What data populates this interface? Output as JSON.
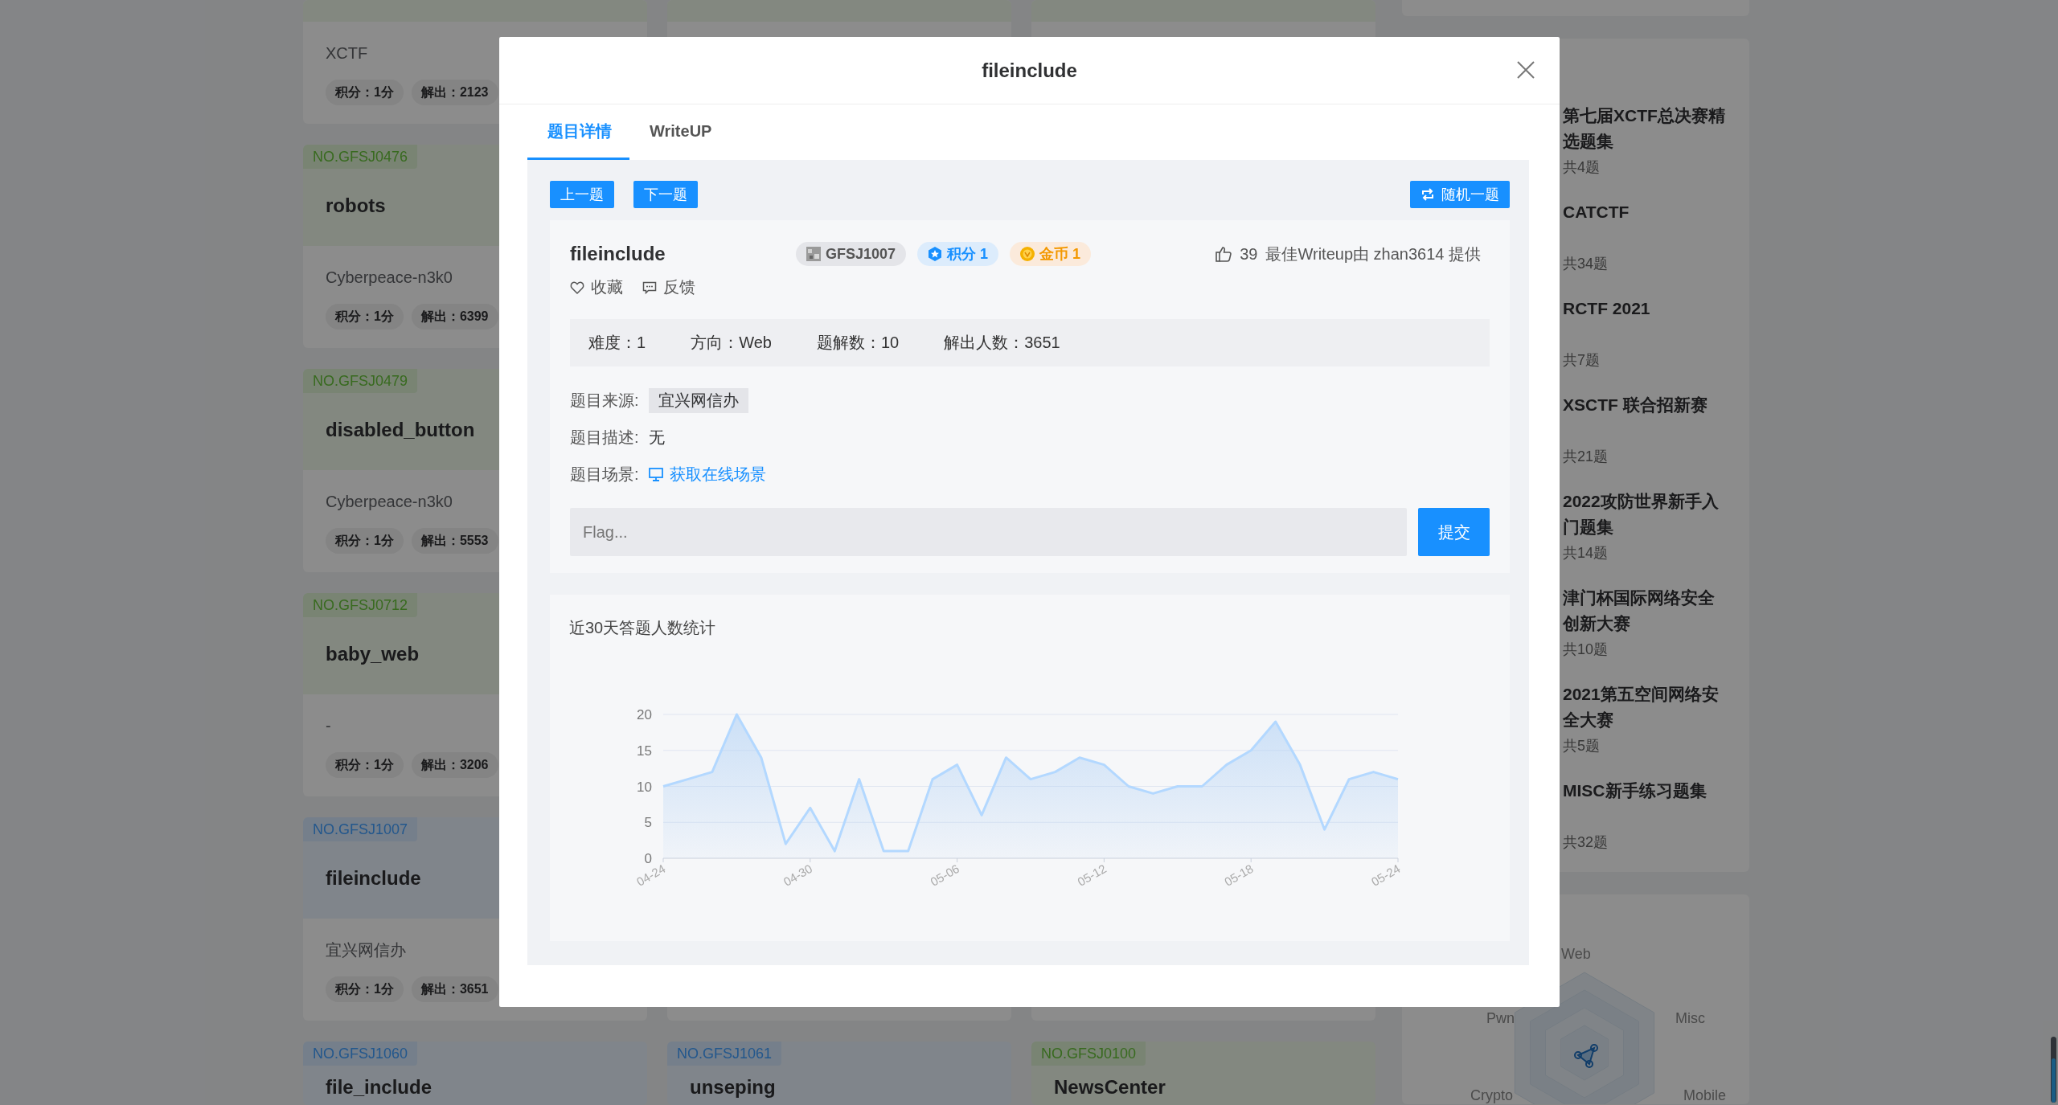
{
  "background": {
    "challenge_grid": {
      "rows": [
        [
          {
            "kind": "green",
            "author": "XCTF",
            "points": "积分：1分",
            "solves": "解出：2123"
          },
          {
            "kind": "green"
          },
          {
            "kind": "green"
          }
        ],
        [
          {
            "kind": "green",
            "tag": "NO.GFSJ0476",
            "title": "robots",
            "author": "Cyberpeace-n3k0",
            "points": "积分：1分",
            "solves": "解出：6399"
          }
        ],
        [
          {
            "kind": "green",
            "tag": "NO.GFSJ0479",
            "title": "disabled_button",
            "author": "Cyberpeace-n3k0",
            "points": "积分：1分",
            "solves": "解出：5553"
          }
        ],
        [
          {
            "kind": "green",
            "tag": "NO.GFSJ0712",
            "title": "baby_web",
            "author": "-",
            "points": "积分：1分",
            "solves": "解出：3206"
          }
        ],
        [
          {
            "kind": "blue",
            "tag": "NO.GFSJ1007",
            "title": "fileinclude",
            "author": "宜兴网信办",
            "points": "积分：1分",
            "solves": "解出：3651"
          }
        ],
        [
          {
            "kind": "blue",
            "tag": "NO.GFSJ1060",
            "title": "file_include"
          },
          {
            "kind": "blue",
            "tag": "NO.GFSJ1061",
            "title": "unseping"
          },
          {
            "kind": "green",
            "tag": "NO.GFSJ0100",
            "title": "NewsCenter"
          }
        ]
      ]
    },
    "collections": {
      "items": [
        {
          "title": "第七届XCTF总决赛精选题集",
          "count": "共4题"
        },
        {
          "title": "CATCTF",
          "count": "共34题"
        },
        {
          "title": "RCTF 2021",
          "count": "共7题"
        },
        {
          "title": "XSCTF 联合招新赛",
          "count": "共21题"
        },
        {
          "title": "2022攻防世界新手入门题集",
          "count": "共14题"
        },
        {
          "title": "津门杯国际网络安全创新大赛",
          "count": "共10题"
        },
        {
          "title": "2021第五空间网络安全大赛",
          "count": "共5题"
        },
        {
          "title": "MISC新手练习题集",
          "count": "共32题"
        }
      ]
    },
    "skill_radar": {
      "axes": [
        "Web",
        "Pwn",
        "Misc",
        "Crypto",
        "Mobile"
      ]
    }
  },
  "modal": {
    "title": "fileinclude",
    "tabs": [
      {
        "label": "题目详情",
        "selected": true
      },
      {
        "label": "WriteUP",
        "selected": false
      }
    ],
    "nav_buttons": [
      "上一题",
      "下一题"
    ],
    "random_button": "随机一题",
    "challenge": {
      "name": "fileinclude",
      "badges": [
        {
          "kind": "id",
          "text": "GFSJ1007"
        },
        {
          "kind": "score",
          "text": "积分 1"
        },
        {
          "kind": "coin",
          "text": "金币 1"
        }
      ],
      "likes": "39",
      "best_writeup": "最佳Writeup由 zhan3614 提供",
      "actions": [
        {
          "kind": "favorite",
          "label": "收藏"
        },
        {
          "kind": "feedback",
          "label": "反馈"
        }
      ],
      "stats": [
        "难度：1",
        "方向：Web",
        "题解数：10",
        "解出人数：3651"
      ],
      "fields": [
        {
          "kind": "tag",
          "label": "题目来源:",
          "value": "宜兴网信办"
        },
        {
          "kind": "text",
          "label": "题目描述:",
          "value": "无"
        },
        {
          "kind": "link",
          "label": "题目场景:",
          "value": "获取在线场景"
        }
      ],
      "flag": {
        "placeholder": "Flag...",
        "submit": "提交"
      }
    },
    "chart": {
      "title": "近30天答题人数统计",
      "chart_data": {
        "type": "area",
        "categories": [
          "04-24",
          null,
          null,
          null,
          null,
          null,
          "04-30",
          null,
          null,
          null,
          null,
          null,
          "05-06",
          null,
          null,
          null,
          null,
          null,
          "05-12",
          null,
          null,
          null,
          null,
          null,
          "05-18",
          null,
          null,
          null,
          null,
          null,
          "05-24"
        ],
        "series": [
          {
            "color": "#b3d8ff",
            "values": [
              10,
              11,
              12,
              20,
              14,
              2,
              7,
              1,
              11,
              1,
              1,
              11,
              13,
              6,
              14,
              11,
              12,
              14,
              13,
              10,
              9,
              10,
              10,
              13,
              15,
              19,
              13,
              4,
              11,
              12,
              11
            ]
          }
        ],
        "grid": true,
        "ylim": [
          0,
          20
        ],
        "yticks": [
          0,
          5,
          10,
          15,
          20
        ]
      }
    }
  }
}
